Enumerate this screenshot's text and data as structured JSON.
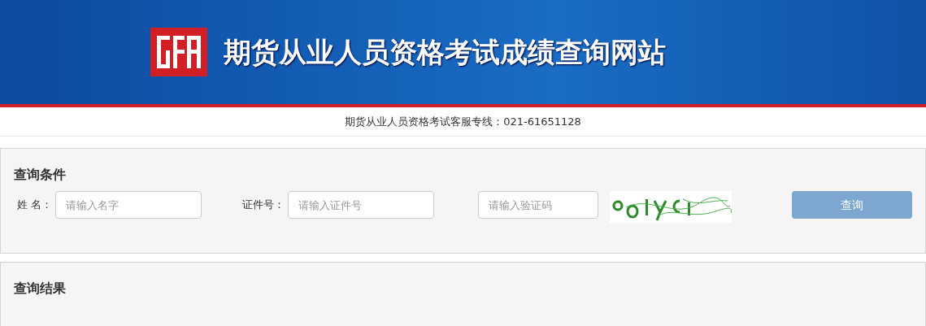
{
  "header": {
    "title": "期货从业人员资格考试成绩查询网站"
  },
  "hotline": "期货从业人员资格考试客服专线：021-61651128",
  "query_panel": {
    "title": "查询条件",
    "fields": [
      {
        "label": "姓 名：",
        "placeholder": "请输入名字"
      },
      {
        "label": "证件号：",
        "placeholder": "请输入证件号"
      },
      {
        "placeholder": "请输入验证码"
      }
    ],
    "button": "查询"
  },
  "result_panel": {
    "title": "查询结果"
  }
}
